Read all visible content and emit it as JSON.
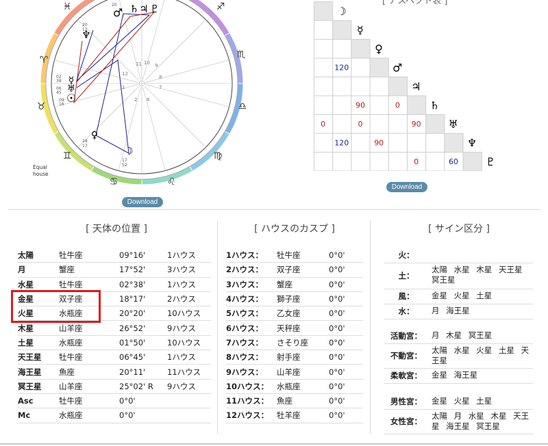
{
  "chart": {
    "download_label": "Download",
    "house_system": [
      "Equal",
      "house"
    ],
    "top_degrees": [
      "20"
    ],
    "left_degrees": [
      "02",
      "38",
      "06",
      "45",
      "09",
      "16"
    ],
    "mid_degrees": [
      "20",
      "11"
    ],
    "bottom_degrees": [
      "18",
      "17",
      "17",
      "52"
    ],
    "house_numbers": [
      "11",
      "10",
      "9",
      "12",
      "8",
      "1",
      "7",
      "2",
      "6"
    ]
  },
  "aspect_table": {
    "title": "[ アスペクト表 ]",
    "download_label": "Download",
    "planet_glyphs": [
      "☽",
      "☿",
      "♀",
      "♂",
      "♃",
      "♄",
      "♅",
      "♆",
      "♇"
    ],
    "values": [
      {
        "row": 3,
        "col": 1,
        "text": "120",
        "color": "#1a2a8a"
      },
      {
        "row": 5,
        "col": 2,
        "text": "90",
        "color": "#b02020"
      },
      {
        "row": 5,
        "col": 4,
        "text": "0",
        "color": "#b02020"
      },
      {
        "row": 6,
        "col": 0,
        "text": "0",
        "color": "#b02020"
      },
      {
        "row": 6,
        "col": 2,
        "text": "0",
        "color": "#b02020"
      },
      {
        "row": 6,
        "col": 5,
        "text": "90",
        "color": "#b02020"
      },
      {
        "row": 7,
        "col": 1,
        "text": "120",
        "color": "#1a2a8a"
      },
      {
        "row": 7,
        "col": 3,
        "text": "90",
        "color": "#b02020"
      },
      {
        "row": 8,
        "col": 5,
        "text": "0",
        "color": "#b02020"
      },
      {
        "row": 8,
        "col": 7,
        "text": "60",
        "color": "#1a2a8a"
      }
    ]
  },
  "planet_positions": {
    "title": "[ 天体の位置 ]",
    "rows": [
      {
        "name": "太陽",
        "sign": "牡牛座",
        "degree": "09°16'",
        "house": "1ハウス"
      },
      {
        "name": "月",
        "sign": "蟹座",
        "degree": "17°52'",
        "house": "3ハウス"
      },
      {
        "name": "水星",
        "sign": "牡牛座",
        "degree": "02°38'",
        "house": "1ハウス"
      },
      {
        "name": "金星",
        "sign": "双子座",
        "degree": "18°17'",
        "house": "2ハウス"
      },
      {
        "name": "火星",
        "sign": "水瓶座",
        "degree": "20°20'",
        "house": "10ハウス"
      },
      {
        "name": "木星",
        "sign": "山羊座",
        "degree": "26°52'",
        "house": "9ハウス"
      },
      {
        "name": "土星",
        "sign": "水瓶座",
        "degree": "01°50'",
        "house": "10ハウス"
      },
      {
        "name": "天王星",
        "sign": "牡牛座",
        "degree": "06°45'",
        "house": "1ハウス"
      },
      {
        "name": "海王星",
        "sign": "魚座",
        "degree": "20°11'",
        "house": "11ハウス"
      },
      {
        "name": "冥王星",
        "sign": "山羊座",
        "degree": "25°02' R",
        "house": "9ハウス"
      },
      {
        "name": "Asc",
        "sign": "牡牛座",
        "degree": "0°0'",
        "house": ""
      },
      {
        "name": "Mc",
        "sign": "水瓶座",
        "degree": "0°0'",
        "house": ""
      }
    ]
  },
  "house_cusps": {
    "title": "[ ハウスのカスプ ]",
    "rows": [
      {
        "name": "1ハウス：",
        "sign": "牡牛座",
        "degree": "0°0'"
      },
      {
        "name": "2ハウス：",
        "sign": "双子座",
        "degree": "0°0'"
      },
      {
        "name": "3ハウス：",
        "sign": "蟹座",
        "degree": "0°0'"
      },
      {
        "name": "4ハウス：",
        "sign": "獅子座",
        "degree": "0°0'"
      },
      {
        "name": "5ハウス：",
        "sign": "乙女座",
        "degree": "0°0'"
      },
      {
        "name": "6ハウス：",
        "sign": "天秤座",
        "degree": "0°0'"
      },
      {
        "name": "7ハウス：",
        "sign": "さそり座",
        "degree": "0°0'"
      },
      {
        "name": "8ハウス：",
        "sign": "射手座",
        "degree": "0°0'"
      },
      {
        "name": "9ハウス：",
        "sign": "山羊座",
        "degree": "0°0'"
      },
      {
        "name": "10ハウス：",
        "sign": "水瓶座",
        "degree": "0°0'"
      },
      {
        "name": "11ハウス：",
        "sign": "魚座",
        "degree": "0°0'"
      },
      {
        "name": "12ハウス：",
        "sign": "牡羊座",
        "degree": "0°0'"
      }
    ]
  },
  "sign_division": {
    "title": "[ サイン区分 ]",
    "elements": [
      {
        "label": "火：",
        "value": ""
      },
      {
        "label": "土：",
        "value": "太陽 水星 木星 天王星 冥王星"
      },
      {
        "label": "風：",
        "value": "金星 火星 土星"
      },
      {
        "label": "水：",
        "value": "月 海王星"
      }
    ],
    "modes": [
      {
        "label": "活動宮：",
        "value": "月 木星 冥王星"
      },
      {
        "label": "不動宮：",
        "value": "太陽 水星 火星 土星 天王星"
      },
      {
        "label": "柔軟宮：",
        "value": "金星 海王星"
      }
    ],
    "polarity": [
      {
        "label": "男性宮：",
        "value": "金星 火星 土星"
      },
      {
        "label": "女性宮：",
        "value": "太陽 月 水星 木星 天王星 海王星 冥王星"
      }
    ]
  }
}
